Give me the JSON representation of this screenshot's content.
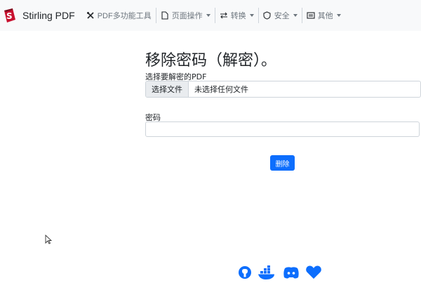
{
  "navbar": {
    "brand": "Stirling PDF",
    "items": [
      {
        "label": "PDF多功能工具",
        "icon": "tools-icon",
        "dropdown": false
      },
      {
        "label": "页面操作",
        "icon": "file-icon",
        "dropdown": true
      },
      {
        "label": "转换",
        "icon": "arrows-exchange-icon",
        "dropdown": true
      },
      {
        "label": "安全",
        "icon": "shield-icon",
        "dropdown": true
      },
      {
        "label": "其他",
        "icon": "card-icon",
        "dropdown": true
      }
    ]
  },
  "main": {
    "title": "移除密码（解密）。",
    "file_label": "选择要解密的PDF",
    "file_button": "选择文件",
    "file_status": "未选择任何文件",
    "password_label": "密码",
    "password_value": "",
    "submit_label": "删除"
  },
  "footer": {
    "icons": [
      "github-icon",
      "docker-icon",
      "discord-icon",
      "heart-icon"
    ]
  },
  "colors": {
    "navbar_bg": "#f8f9fa",
    "primary": "#0d6efd",
    "logo_red": "#c8102e"
  }
}
